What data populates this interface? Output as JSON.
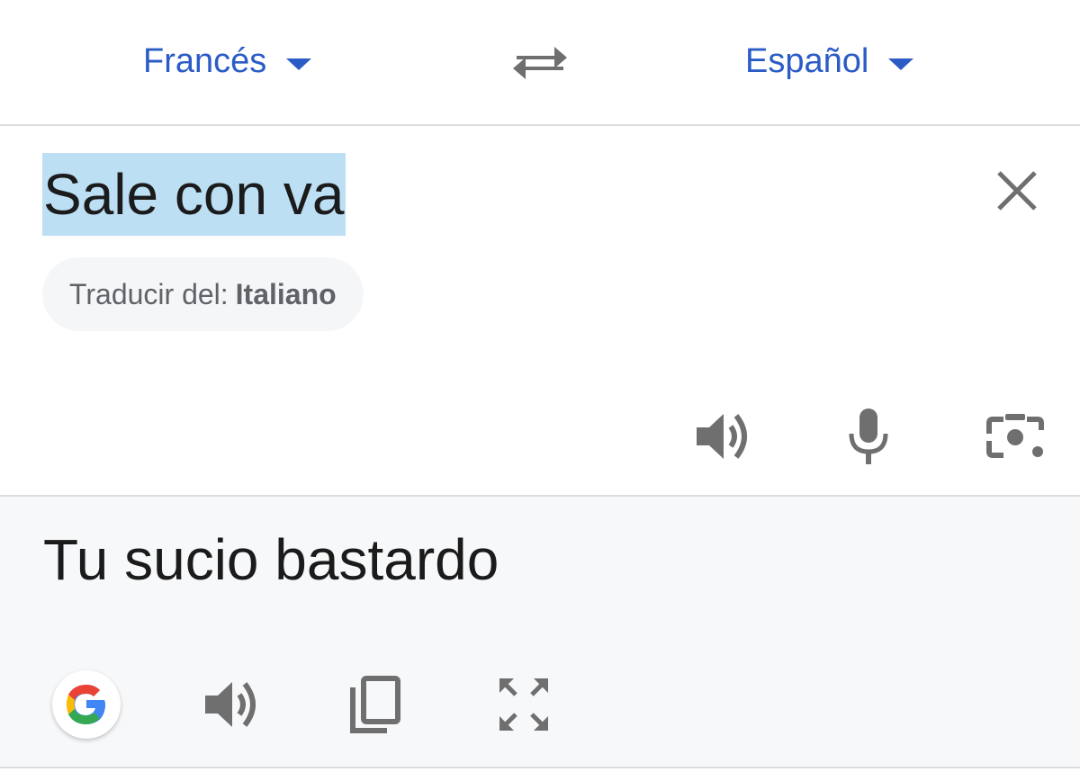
{
  "language_bar": {
    "source_language": "Francés",
    "target_language": "Español"
  },
  "input": {
    "text": "Sale con va",
    "detect_prefix": "Traducir del:",
    "detected_language": "Italiano"
  },
  "output": {
    "translation": "Tu sucio bastardo"
  },
  "colors": {
    "accent": "#2b5cc6",
    "selection": "#bcdff4",
    "icon": "#6f6f6f",
    "output_background": "#f7f8fa"
  },
  "icons": {
    "language_caret": "caret-down-icon",
    "swap": "swap-arrows-icon",
    "clear": "close-icon",
    "source_audio": "speaker-icon",
    "voice_input": "microphone-icon",
    "camera_input": "camera-lens-icon",
    "google": "google-g-icon",
    "output_audio": "speaker-icon",
    "copy": "copy-icon",
    "fullscreen": "expand-icon"
  }
}
